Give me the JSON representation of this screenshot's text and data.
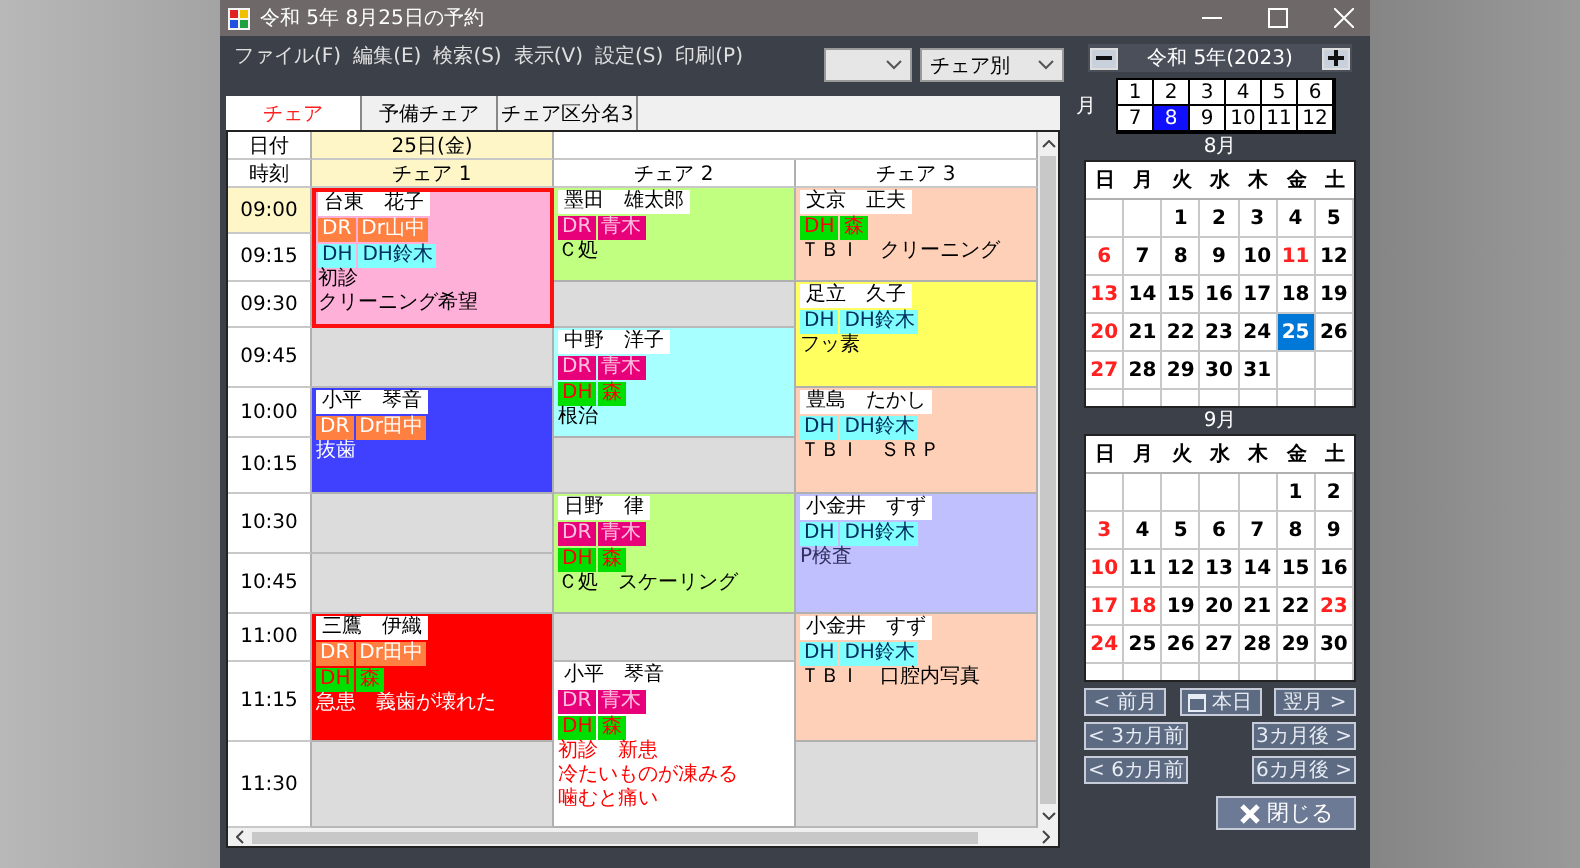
{
  "window": {
    "title": "令和 5年 8月25日の予約"
  },
  "menu": [
    "ファイル(F)",
    "編集(E)",
    "検索(S)",
    "表示(V)",
    "設定(S)",
    "印刷(P)"
  ],
  "view_dropdown": {
    "value": "チェア別"
  },
  "tabs": [
    {
      "label": "チェア",
      "selected": true
    },
    {
      "label": "予備チェア",
      "selected": false
    },
    {
      "label": "チェア区分名3",
      "selected": false
    }
  ],
  "schedule": {
    "date_label": "日付",
    "date": "25日(金)",
    "time_label": "時刻",
    "chairs": [
      {
        "label": "チェア 1",
        "selected": true
      },
      {
        "label": "チェア 2",
        "selected": false
      },
      {
        "label": "チェア 3",
        "selected": false
      }
    ],
    "slots": [
      {
        "time": "09:00",
        "selected": true,
        "cells": [
          {
            "kind": "appointment",
            "selected": true,
            "color": "#ffb0d8",
            "patient": "台東　花子",
            "staff": [
              {
                "role": "DR",
                "name": "Dr山中",
                "color": "#ff8040"
              },
              {
                "role": "DH",
                "name": "DH鈴木",
                "color": "#80ffff"
              }
            ],
            "notes": [
              "初診",
              "クリーニング希望"
            ]
          },
          {
            "kind": "appointment",
            "selected": false,
            "color": "#c0ff80",
            "patient": "墨田　雄太郎",
            "staff": [
              {
                "role": "DR",
                "name": "青木",
                "color": "#e8007a"
              }
            ],
            "notes": [
              "Ｃ処"
            ]
          },
          {
            "kind": "appointment",
            "selected": false,
            "color": "#ffd0b8",
            "patient": "文京　正夫",
            "staff": [
              {
                "role": "DH",
                "name": "森",
                "color": "#00e000"
              }
            ],
            "notes": [
              "ＴＢＩ　クリーニング"
            ]
          }
        ]
      },
      {
        "time": "09:15",
        "selected": false,
        "cells": [
          {
            "kind": "continued"
          },
          {
            "kind": "continued"
          },
          {
            "kind": "continued"
          }
        ]
      },
      {
        "time": "09:30",
        "selected": false,
        "cells": [
          {
            "kind": "continued"
          },
          {
            "kind": "empty"
          },
          {
            "kind": "appointment",
            "selected": false,
            "color": "#ffff60",
            "patient": "足立　久子",
            "staff": [
              {
                "role": "DH",
                "name": "DH鈴木",
                "color": "#80ffff"
              }
            ],
            "notes": [
              "フッ素"
            ]
          }
        ]
      },
      {
        "time": "09:45",
        "selected": false,
        "cells": [
          {
            "kind": "empty"
          },
          {
            "kind": "appointment",
            "selected": false,
            "color": "#a8ffff",
            "patient": "中野　洋子",
            "staff": [
              {
                "role": "DR",
                "name": "青木",
                "color": "#e8007a"
              },
              {
                "role": "DH",
                "name": "森",
                "color": "#00e000"
              }
            ],
            "notes": [
              "根治"
            ]
          },
          {
            "kind": "continued"
          }
        ]
      },
      {
        "time": "10:00",
        "selected": false,
        "cells": [
          {
            "kind": "appointment",
            "selected": false,
            "color": "#4040ff",
            "patient": "小平　琴音",
            "staff": [
              {
                "role": "DR",
                "name": "Dr田中",
                "color": "#ff8040"
              }
            ],
            "notes": [
              "抜歯"
            ]
          },
          {
            "kind": "continued"
          },
          {
            "kind": "appointment",
            "selected": false,
            "color": "#ffd0b8",
            "patient": "豊島　たかし",
            "staff": [
              {
                "role": "DH",
                "name": "DH鈴木",
                "color": "#80ffff"
              }
            ],
            "notes": [
              "ＴＢＩ　ＳＲＰ"
            ]
          }
        ]
      },
      {
        "time": "10:15",
        "selected": false,
        "cells": [
          {
            "kind": "continued"
          },
          {
            "kind": "empty"
          },
          {
            "kind": "continued"
          }
        ]
      },
      {
        "time": "10:30",
        "selected": false,
        "cells": [
          {
            "kind": "empty"
          },
          {
            "kind": "appointment",
            "selected": false,
            "color": "#c0ff80",
            "patient": "日野　律",
            "staff": [
              {
                "role": "DR",
                "name": "青木",
                "color": "#e8007a"
              },
              {
                "role": "DH",
                "name": "森",
                "color": "#00e000"
              }
            ],
            "notes": [
              "Ｃ処　スケーリング"
            ]
          },
          {
            "kind": "appointment",
            "selected": false,
            "color": "#c0c0ff",
            "patient": "小金井　すず",
            "staff": [
              {
                "role": "DH",
                "name": "DH鈴木",
                "color": "#80ffff"
              }
            ],
            "notes": [
              "P検査"
            ]
          }
        ]
      },
      {
        "time": "10:45",
        "selected": false,
        "cells": [
          {
            "kind": "empty"
          },
          {
            "kind": "continued"
          },
          {
            "kind": "continued"
          }
        ]
      },
      {
        "time": "11:00",
        "selected": false,
        "cells": [
          {
            "kind": "appointment",
            "selected": false,
            "color": "#ff0000",
            "patient": "三鷹　伊織",
            "staff": [
              {
                "role": "DR",
                "name": "Dr田中",
                "color": "#ff8040"
              },
              {
                "role": "DH",
                "name": "森",
                "color": "#00e000"
              }
            ],
            "notes": [
              "急患　義歯が壊れた"
            ]
          },
          {
            "kind": "empty"
          },
          {
            "kind": "appointment",
            "selected": false,
            "color": "#ffd0b8",
            "patient": "小金井　すず",
            "staff": [
              {
                "role": "DH",
                "name": "DH鈴木",
                "color": "#80ffff"
              }
            ],
            "notes": [
              "ＴＢＩ　口腔内写真"
            ]
          }
        ]
      },
      {
        "time": "11:15",
        "selected": false,
        "cells": [
          {
            "kind": "continued"
          },
          {
            "kind": "appointment",
            "selected": false,
            "color": "#ffffff",
            "patient": "小平　琴音",
            "staff": [
              {
                "role": "DR",
                "name": "青木",
                "color": "#e8007a"
              },
              {
                "role": "DH",
                "name": "森",
                "color": "#00e000"
              }
            ],
            "notes": [
              "初診　新患",
              "冷たいものが凍みる",
              "噛むと痛い"
            ]
          },
          {
            "kind": "continued"
          }
        ]
      },
      {
        "time": "11:30",
        "selected": false,
        "cells": [
          {
            "kind": "empty"
          },
          {
            "kind": "continued"
          },
          {
            "kind": "empty"
          }
        ]
      }
    ]
  },
  "year_nav": {
    "label": "令和 5年(2023)"
  },
  "month_picker": {
    "label": "月",
    "months": [
      {
        "label": "1",
        "selected": false
      },
      {
        "label": "2",
        "selected": false
      },
      {
        "label": "3",
        "selected": false
      },
      {
        "label": "4",
        "selected": false
      },
      {
        "label": "5",
        "selected": false
      },
      {
        "label": "6",
        "selected": false
      },
      {
        "label": "7",
        "selected": false
      },
      {
        "label": "8",
        "selected": true
      },
      {
        "label": "9",
        "selected": false
      },
      {
        "label": "10",
        "selected": false
      },
      {
        "label": "11",
        "selected": false
      },
      {
        "label": "12",
        "selected": false
      }
    ]
  },
  "calendars": [
    {
      "title": "8月",
      "weekdays": [
        "日",
        "月",
        "火",
        "水",
        "木",
        "金",
        "土"
      ],
      "weeks": [
        [
          {
            "kind": "blank"
          },
          {
            "kind": "blank"
          },
          {
            "kind": "day",
            "day": "1",
            "holiday": false,
            "selected": false
          },
          {
            "kind": "day",
            "day": "2",
            "holiday": false,
            "selected": false
          },
          {
            "kind": "day",
            "day": "3",
            "holiday": false,
            "selected": false
          },
          {
            "kind": "day",
            "day": "4",
            "holiday": false,
            "selected": false
          },
          {
            "kind": "day",
            "day": "5",
            "holiday": false,
            "selected": false
          }
        ],
        [
          {
            "kind": "day",
            "day": "6",
            "holiday": true,
            "selected": false
          },
          {
            "kind": "day",
            "day": "7",
            "holiday": false,
            "selected": false
          },
          {
            "kind": "day",
            "day": "8",
            "holiday": false,
            "selected": false
          },
          {
            "kind": "day",
            "day": "9",
            "holiday": false,
            "selected": false
          },
          {
            "kind": "day",
            "day": "10",
            "holiday": false,
            "selected": false
          },
          {
            "kind": "day",
            "day": "11",
            "holiday": true,
            "selected": false
          },
          {
            "kind": "day",
            "day": "12",
            "holiday": false,
            "selected": false
          }
        ],
        [
          {
            "kind": "day",
            "day": "13",
            "holiday": true,
            "selected": false
          },
          {
            "kind": "day",
            "day": "14",
            "holiday": false,
            "selected": false
          },
          {
            "kind": "day",
            "day": "15",
            "holiday": false,
            "selected": false
          },
          {
            "kind": "day",
            "day": "16",
            "holiday": false,
            "selected": false
          },
          {
            "kind": "day",
            "day": "17",
            "holiday": false,
            "selected": false
          },
          {
            "kind": "day",
            "day": "18",
            "holiday": false,
            "selected": false
          },
          {
            "kind": "day",
            "day": "19",
            "holiday": false,
            "selected": false
          }
        ],
        [
          {
            "kind": "day",
            "day": "20",
            "holiday": true,
            "selected": false
          },
          {
            "kind": "day",
            "day": "21",
            "holiday": false,
            "selected": false
          },
          {
            "kind": "day",
            "day": "22",
            "holiday": false,
            "selected": false
          },
          {
            "kind": "day",
            "day": "23",
            "holiday": false,
            "selected": false
          },
          {
            "kind": "day",
            "day": "24",
            "holiday": false,
            "selected": false
          },
          {
            "kind": "day",
            "day": "25",
            "holiday": false,
            "selected": true
          },
          {
            "kind": "day",
            "day": "26",
            "holiday": false,
            "selected": false
          }
        ],
        [
          {
            "kind": "day",
            "day": "27",
            "holiday": true,
            "selected": false
          },
          {
            "kind": "day",
            "day": "28",
            "holiday": false,
            "selected": false
          },
          {
            "kind": "day",
            "day": "29",
            "holiday": false,
            "selected": false
          },
          {
            "kind": "day",
            "day": "30",
            "holiday": false,
            "selected": false
          },
          {
            "kind": "day",
            "day": "31",
            "holiday": false,
            "selected": false
          },
          {
            "kind": "blank"
          },
          {
            "kind": "blank"
          }
        ]
      ]
    },
    {
      "title": "9月",
      "weekdays": [
        "日",
        "月",
        "火",
        "水",
        "木",
        "金",
        "土"
      ],
      "weeks": [
        [
          {
            "kind": "blank"
          },
          {
            "kind": "blank"
          },
          {
            "kind": "blank"
          },
          {
            "kind": "blank"
          },
          {
            "kind": "blank"
          },
          {
            "kind": "day",
            "day": "1",
            "holiday": false,
            "selected": false
          },
          {
            "kind": "day",
            "day": "2",
            "holiday": false,
            "selected": false
          }
        ],
        [
          {
            "kind": "day",
            "day": "3",
            "holiday": true,
            "selected": false
          },
          {
            "kind": "day",
            "day": "4",
            "holiday": false,
            "selected": false
          },
          {
            "kind": "day",
            "day": "5",
            "holiday": false,
            "selected": false
          },
          {
            "kind": "day",
            "day": "6",
            "holiday": false,
            "selected": false
          },
          {
            "kind": "day",
            "day": "7",
            "holiday": false,
            "selected": false
          },
          {
            "kind": "day",
            "day": "8",
            "holiday": false,
            "selected": false
          },
          {
            "kind": "day",
            "day": "9",
            "holiday": false,
            "selected": false
          }
        ],
        [
          {
            "kind": "day",
            "day": "10",
            "holiday": true,
            "selected": false
          },
          {
            "kind": "day",
            "day": "11",
            "holiday": false,
            "selected": false
          },
          {
            "kind": "day",
            "day": "12",
            "holiday": false,
            "selected": false
          },
          {
            "kind": "day",
            "day": "13",
            "holiday": false,
            "selected": false
          },
          {
            "kind": "day",
            "day": "14",
            "holiday": false,
            "selected": false
          },
          {
            "kind": "day",
            "day": "15",
            "holiday": false,
            "selected": false
          },
          {
            "kind": "day",
            "day": "16",
            "holiday": false,
            "selected": false
          }
        ],
        [
          {
            "kind": "day",
            "day": "17",
            "holiday": true,
            "selected": false
          },
          {
            "kind": "day",
            "day": "18",
            "holiday": true,
            "selected": false
          },
          {
            "kind": "day",
            "day": "19",
            "holiday": false,
            "selected": false
          },
          {
            "kind": "day",
            "day": "20",
            "holiday": false,
            "selected": false
          },
          {
            "kind": "day",
            "day": "21",
            "holiday": false,
            "selected": false
          },
          {
            "kind": "day",
            "day": "22",
            "holiday": false,
            "selected": false
          },
          {
            "kind": "day",
            "day": "23",
            "holiday": true,
            "selected": false
          }
        ],
        [
          {
            "kind": "day",
            "day": "24",
            "holiday": true,
            "selected": false
          },
          {
            "kind": "day",
            "day": "25",
            "holiday": false,
            "selected": false
          },
          {
            "kind": "day",
            "day": "26",
            "holiday": false,
            "selected": false
          },
          {
            "kind": "day",
            "day": "27",
            "holiday": false,
            "selected": false
          },
          {
            "kind": "day",
            "day": "28",
            "holiday": false,
            "selected": false
          },
          {
            "kind": "day",
            "day": "29",
            "holiday": false,
            "selected": false
          },
          {
            "kind": "day",
            "day": "30",
            "holiday": false,
            "selected": false
          }
        ]
      ]
    }
  ],
  "nav_buttons": [
    [
      {
        "label": "< 前月",
        "kind": "plain"
      },
      {
        "label": "本日",
        "kind": "today"
      },
      {
        "label": "翌月 >",
        "kind": "plain"
      }
    ],
    [
      {
        "label": "< 3カ月前",
        "kind": "plain"
      },
      {
        "label": "3カ月後 >",
        "kind": "plain"
      }
    ],
    [
      {
        "label": "< 6カ月前",
        "kind": "plain"
      },
      {
        "label": "6カ月後 >",
        "kind": "plain"
      }
    ]
  ],
  "close_button": {
    "label": "閉じる"
  }
}
